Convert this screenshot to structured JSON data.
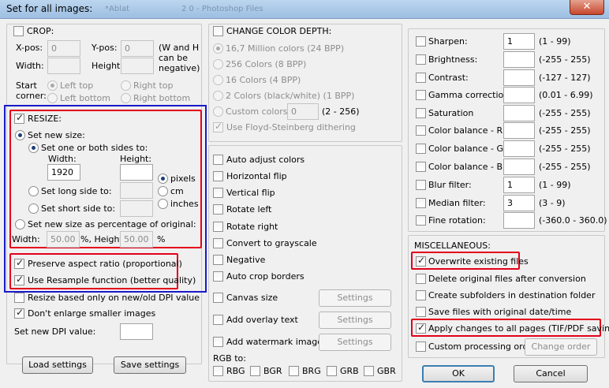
{
  "window": {
    "title": "Set for all images:",
    "ghost_a": "*Ablat",
    "ghost_b": "2 0 - Photoshop Files",
    "close": "✕"
  },
  "crop": {
    "label": "CROP:",
    "xpos": "X-pos:",
    "xpos_val": "0",
    "ypos": "Y-pos:",
    "ypos_val": "0",
    "width": "Width:",
    "height": "Height:",
    "note1": "(W and H",
    "note2": "can be",
    "note3": "negative)",
    "start1": "Start",
    "start2": "corner:",
    "left_top": "Left top",
    "right_top": "Right top",
    "left_bottom": "Left bottom",
    "right_bottom": "Right bottom"
  },
  "resize": {
    "label": "RESIZE:",
    "set_new_size": "Set new size:",
    "one_or_both": "Set one or both sides to:",
    "width": "Width:",
    "height": "Height:",
    "width_val": "1920",
    "height_val": "",
    "pixels": "pixels",
    "cm": "cm",
    "inches": "inches",
    "long_side": "Set long side to:",
    "short_side": "Set short side to:",
    "percentage": "Set new size as percentage of original:",
    "pct_width": "Width:",
    "pct_width_val": "50.00",
    "pct_sep": "%, Height:",
    "pct_height_val": "50.00",
    "pct_end": "%",
    "preserve": "Preserve aspect ratio (proportional)",
    "resample": "Use Resample function (better quality)",
    "dpi_based": "Resize based only on new/old DPI value",
    "dont_enlarge": "Don't enlarge smaller images",
    "new_dpi": "Set new DPI value:",
    "new_dpi_val": ""
  },
  "buttons": {
    "load": "Load settings",
    "save": "Save settings",
    "ok": "OK",
    "cancel": "Cancel",
    "settings": "Settings",
    "change_order": "Change order"
  },
  "color_depth": {
    "label": "CHANGE COLOR DEPTH:",
    "c24": "16,7 Million colors (24 BPP)",
    "c8": "256 Colors (8 BPP)",
    "c4": "16 Colors (4 BPP)",
    "c1": "2 Colors (black/white) (1 BPP)",
    "custom": "Custom colors:",
    "custom_val": "0",
    "custom_range": "(2 - 256)",
    "dither": "Use Floyd-Steinberg dithering"
  },
  "transforms": {
    "auto_adjust": "Auto adjust colors",
    "hflip": "Horizontal flip",
    "vflip": "Vertical flip",
    "rot_left": "Rotate left",
    "rot_right": "Rotate right",
    "grayscale": "Convert to grayscale",
    "negative": "Negative",
    "auto_crop": "Auto crop borders",
    "canvas": "Canvas size",
    "overlay": "Add overlay text",
    "watermark": "Add watermark image",
    "rgb_to": "RGB to:",
    "rbg": "RBG",
    "bgr": "BGR",
    "brg": "BRG",
    "grb": "GRB",
    "gbr": "GBR"
  },
  "adjust": {
    "sharpen": "Sharpen:",
    "sharpen_val": "1",
    "sharpen_range": "(1  -  99)",
    "brightness": "Brightness:",
    "brightness_range": "(-255  -  255)",
    "contrast": "Contrast:",
    "contrast_range": "(-127  -  127)",
    "gamma": "Gamma correction:",
    "gamma_range": "(0.01  -  6.99)",
    "saturation": "Saturation",
    "saturation_range": "(-255  -  255)",
    "cb_r": "Color balance - R:",
    "cb_r_range": "(-255  -  255)",
    "cb_g": "Color balance - G:",
    "cb_g_range": "(-255  -  255)",
    "cb_b": "Color balance - B:",
    "cb_b_range": "(-255  -  255)",
    "blur": "Blur filter:",
    "blur_val": "1",
    "blur_range": "(1  -  99)",
    "median": "Median filter:",
    "median_val": "3",
    "median_range": "(3  -  9)",
    "fine_rot": "Fine rotation:",
    "fine_rot_range": "(-360.0  -  360.0)"
  },
  "misc": {
    "label": "MISCELLANEOUS:",
    "overwrite": "Overwrite existing files",
    "delete_orig": "Delete original files after conversion",
    "subfolders": "Create subfolders in destination folder",
    "save_date": "Save files with original date/time",
    "all_pages": "Apply changes to all pages (TIF/PDF saving)",
    "custom_order": "Custom processing order"
  }
}
